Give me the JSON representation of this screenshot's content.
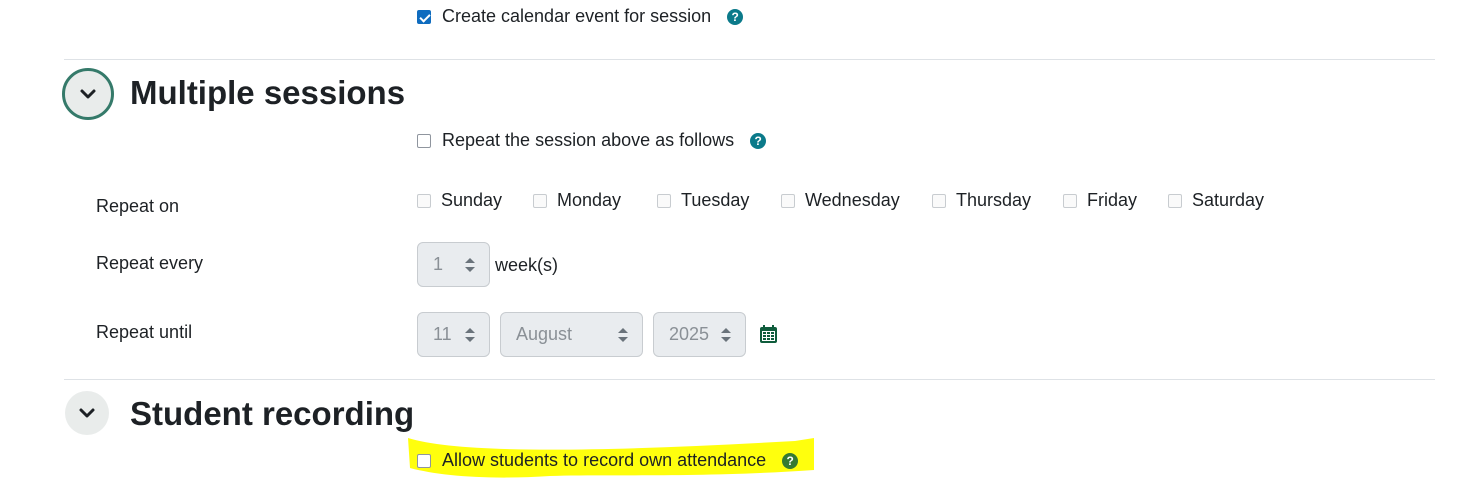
{
  "calendar_event": {
    "label": "Create calendar event for session",
    "checked": true
  },
  "multiple_sessions": {
    "title": "Multiple sessions",
    "repeat_label": "Repeat the session above as follows",
    "repeat_on_label": "Repeat on",
    "days": [
      "Sunday",
      "Monday",
      "Tuesday",
      "Wednesday",
      "Thursday",
      "Friday",
      "Saturday"
    ],
    "repeat_every_label": "Repeat every",
    "repeat_every_value": "1",
    "repeat_every_unit": "week(s)",
    "repeat_until_label": "Repeat until",
    "until_day": "11",
    "until_month": "August",
    "until_year": "2025"
  },
  "student_recording": {
    "title": "Student recording",
    "allow_label": "Allow students to record own attendance"
  },
  "colors": {
    "help_blue": "#0f6cbf",
    "help_teal": "#0b7a8a",
    "help_green": "#357a32",
    "highlight": "#ffff00",
    "toggle_ring": "#357a6a",
    "calendar_green": "#0f5c3c"
  },
  "icons": {
    "help": "question-circle-icon",
    "toggle": "chevron-down-icon",
    "calendar": "calendar-icon"
  }
}
